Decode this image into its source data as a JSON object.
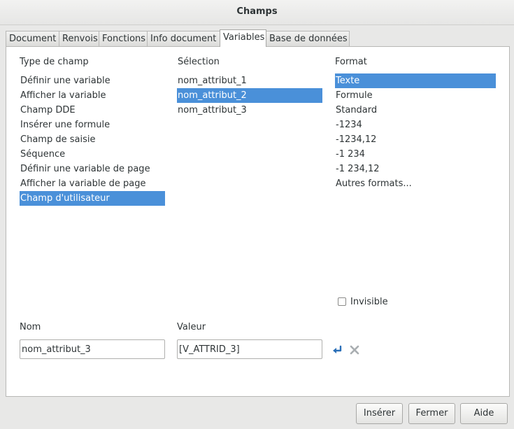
{
  "window": {
    "title": "Champs"
  },
  "tabs": [
    {
      "label": "Document"
    },
    {
      "label": "Renvois"
    },
    {
      "label": "Fonctions"
    },
    {
      "label": "Info document"
    },
    {
      "label": "Variables",
      "active": true
    },
    {
      "label": "Base de données"
    }
  ],
  "type_de_champ": {
    "heading": "Type de champ",
    "items": [
      "Définir une variable",
      "Afficher la variable",
      "Champ DDE",
      "Insérer une formule",
      "Champ de saisie",
      "Séquence",
      "Définir une variable de page",
      "Afficher la variable de page",
      "Champ d'utilisateur"
    ],
    "selected": "Champ d'utilisateur"
  },
  "selection": {
    "heading": "Sélection",
    "items": [
      "nom_attribut_1",
      "nom_attribut_2",
      "nom_attribut_3"
    ],
    "selected": "nom_attribut_2"
  },
  "format": {
    "heading": "Format",
    "items": [
      "Texte",
      "Formule",
      "Standard",
      "-1234",
      "-1234,12",
      "-1 234",
      "-1 234,12",
      "Autres formats..."
    ],
    "selected": "Texte"
  },
  "invisible": {
    "label": "Invisible",
    "checked": false
  },
  "nom": {
    "label": "Nom",
    "value": "nom_attribut_3"
  },
  "valeur": {
    "label": "Valeur",
    "value": "[V_ATTRID_3]"
  },
  "icons": {
    "apply": "apply-arrow-icon",
    "delete": "delete-x-icon",
    "accent": "#4a90d9"
  },
  "buttons": {
    "insert": "Insérer",
    "close": "Fermer",
    "help": "Aide"
  }
}
